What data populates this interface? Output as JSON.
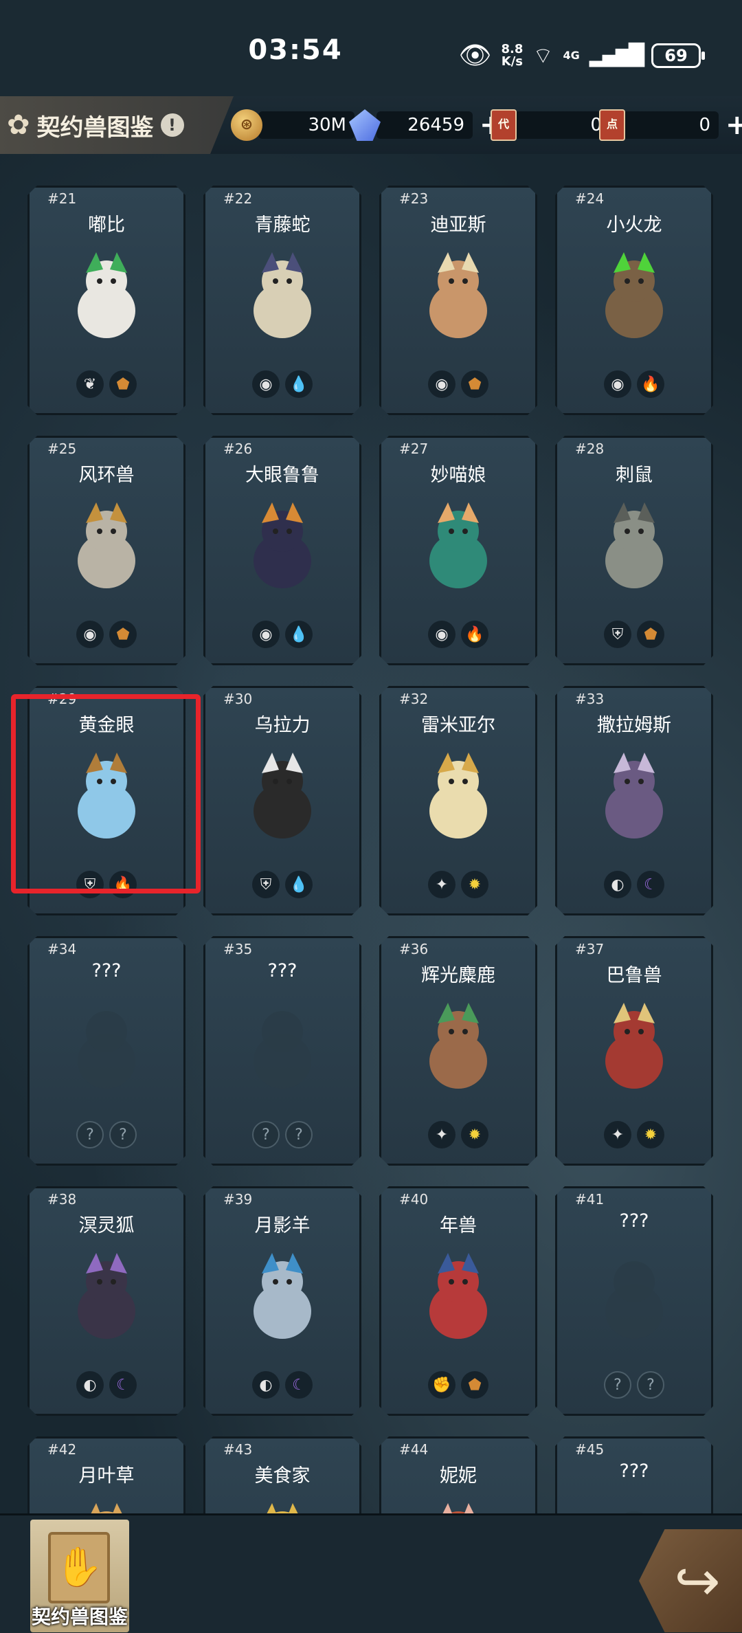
{
  "status_bar": {
    "time": "03:54",
    "net_speed_top": "8.8",
    "net_speed_bottom": "K/s",
    "signal_label": "4G",
    "battery": "69"
  },
  "header": {
    "title": "契约兽图鉴",
    "info_icon": "!",
    "gold": "30M",
    "crystals": "26459",
    "ticket1_label": "代",
    "ticket1_count": "0",
    "ticket2_label": "点",
    "ticket2_count": "0"
  },
  "cards": [
    {
      "num": "#21",
      "name": "嘟比",
      "art_color": "#e9e7e1",
      "accent": "#3fae5a",
      "badges": [
        "leaf",
        "earth"
      ]
    },
    {
      "num": "#22",
      "name": "青藤蛇",
      "art_color": "#d8cfb5",
      "accent": "#4b4f7a",
      "badges": [
        "ghost",
        "water"
      ]
    },
    {
      "num": "#23",
      "name": "迪亚斯",
      "art_color": "#c9966a",
      "accent": "#e8d9b0",
      "badges": [
        "ghost",
        "earth"
      ]
    },
    {
      "num": "#24",
      "name": "小火龙",
      "art_color": "#7a6145",
      "accent": "#4fd33a",
      "badges": [
        "ghost",
        "fire"
      ]
    },
    {
      "num": "#25",
      "name": "风环兽",
      "art_color": "#b9b3a5",
      "accent": "#c4913d",
      "badges": [
        "ghost",
        "earth"
      ]
    },
    {
      "num": "#26",
      "name": "大眼鲁鲁",
      "art_color": "#2f2f4d",
      "accent": "#d88a35",
      "badges": [
        "ghost",
        "water"
      ]
    },
    {
      "num": "#27",
      "name": "妙喵娘",
      "art_color": "#2f8a78",
      "accent": "#e6a96a",
      "badges": [
        "ghost",
        "fire"
      ]
    },
    {
      "num": "#28",
      "name": "刺鼠",
      "art_color": "#8a8f86",
      "accent": "#5b5f5a",
      "badges": [
        "shield",
        "earth"
      ]
    },
    {
      "num": "#29",
      "name": "黄金眼",
      "art_color": "#8fc8e8",
      "accent": "#b07d3a",
      "badges": [
        "shield",
        "fire"
      ]
    },
    {
      "num": "#30",
      "name": "乌拉力",
      "art_color": "#2a2a2a",
      "accent": "#e6e6e6",
      "badges": [
        "shield",
        "water"
      ]
    },
    {
      "num": "#32",
      "name": "雷米亚尔",
      "art_color": "#eadcae",
      "accent": "#d7a94a",
      "badges": [
        "cross",
        "light"
      ]
    },
    {
      "num": "#33",
      "name": "撒拉姆斯",
      "art_color": "#6a5a82",
      "accent": "#c7b8d8",
      "badges": [
        "eye",
        "dark"
      ]
    },
    {
      "num": "#34",
      "name": "???",
      "art_color": "#2b3c47",
      "accent": "#2b3c47",
      "badges": [
        "unknown",
        "unknown"
      ]
    },
    {
      "num": "#35",
      "name": "???",
      "art_color": "#2b3c47",
      "accent": "#2b3c47",
      "badges": [
        "unknown",
        "unknown"
      ]
    },
    {
      "num": "#36",
      "name": "辉光麋鹿",
      "art_color": "#9b6a4a",
      "accent": "#4a9a5a",
      "badges": [
        "cross",
        "light"
      ]
    },
    {
      "num": "#37",
      "name": "巴鲁兽",
      "art_color": "#a43a32",
      "accent": "#e0c47a",
      "badges": [
        "cross",
        "light"
      ]
    },
    {
      "num": "#38",
      "name": "溟灵狐",
      "art_color": "#3a3448",
      "accent": "#8f6ac0",
      "badges": [
        "eye",
        "dark"
      ]
    },
    {
      "num": "#39",
      "name": "月影羊",
      "art_color": "#a7b9c9",
      "accent": "#3f8fc8",
      "badges": [
        "eye",
        "dark"
      ]
    },
    {
      "num": "#40",
      "name": "年兽",
      "art_color": "#b73a3a",
      "accent": "#3a5a9a",
      "badges": [
        "fist",
        "earth"
      ]
    },
    {
      "num": "#41",
      "name": "???",
      "art_color": "#2b3c47",
      "accent": "#2b3c47",
      "badges": [
        "unknown",
        "unknown"
      ]
    },
    {
      "num": "#42",
      "name": "月叶草",
      "art_color": "#d9a55a",
      "accent": "#d9a55a",
      "badges": []
    },
    {
      "num": "#43",
      "name": "美食家",
      "art_color": "#e0b84a",
      "accent": "#e0b84a",
      "badges": []
    },
    {
      "num": "#44",
      "name": "妮妮",
      "art_color": "#c0553a",
      "accent": "#e8b0a0",
      "badges": []
    },
    {
      "num": "#45",
      "name": "???",
      "art_color": "#2b3c47",
      "accent": "#2b3c47",
      "badges": []
    }
  ],
  "bottom": {
    "tab_label": "契约兽图鉴"
  }
}
